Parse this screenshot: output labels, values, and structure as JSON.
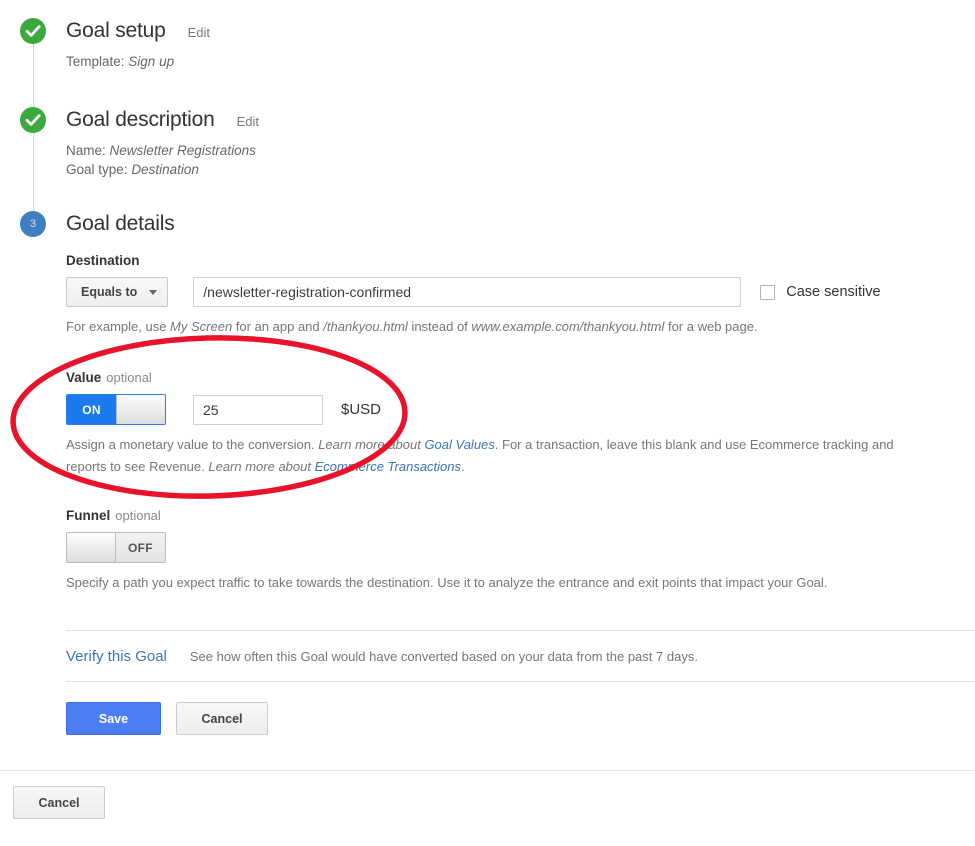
{
  "steps": [
    {
      "marker": "check",
      "title": "Goal setup",
      "edit_label": "Edit",
      "summary_label": "Template:",
      "summary_value": "Sign up"
    },
    {
      "marker": "check",
      "title": "Goal description",
      "edit_label": "Edit",
      "name_label": "Name:",
      "name_value": "Newsletter Registrations",
      "type_label": "Goal type:",
      "type_value": "Destination"
    },
    {
      "marker": "3",
      "title": "Goal details"
    }
  ],
  "destination": {
    "label": "Destination",
    "match_type": "Equals to",
    "value": "/newsletter-registration-confirmed",
    "placeholder": "",
    "case_sensitive_label": "Case sensitive",
    "case_sensitive_checked": false,
    "helper": {
      "t1": "For example, use ",
      "em1": "My Screen",
      "t2": " for an app and ",
      "em2": "/thankyou.html",
      "t3": " instead of ",
      "em3": "www.example.com/thankyou.html",
      "t4": " for a web page."
    }
  },
  "value": {
    "label": "Value",
    "optional": "optional",
    "toggle_state": "ON",
    "amount": "25",
    "currency": "$USD",
    "helper": {
      "t1": "Assign a monetary value to the conversion. ",
      "em1": "Learn more about ",
      "link1": "Goal Values",
      "t2": ". For a transaction, leave this blank and use Ecommerce tracking and reports to see Revenue. ",
      "em2": "Learn more about ",
      "link2": "Ecommerce Transactions",
      "t3": "."
    }
  },
  "funnel": {
    "label": "Funnel",
    "optional": "optional",
    "toggle_state": "OFF",
    "helper": "Specify a path you expect traffic to take towards the destination. Use it to analyze the entrance and exit points that impact your Goal."
  },
  "verify": {
    "link_label": "Verify this Goal",
    "description": "See how often this Goal would have converted based on your data from the past 7 days."
  },
  "actions": {
    "save_label": "Save",
    "cancel_label": "Cancel"
  },
  "footer": {
    "cancel_label": "Cancel"
  },
  "colors": {
    "step_done": "#3ba93b",
    "step_current": "#3f7fc1",
    "toggle_on": "#1a7aee",
    "primary_button": "#4a7ef2",
    "link": "#3b73b9",
    "annotation": "#e8132a"
  }
}
